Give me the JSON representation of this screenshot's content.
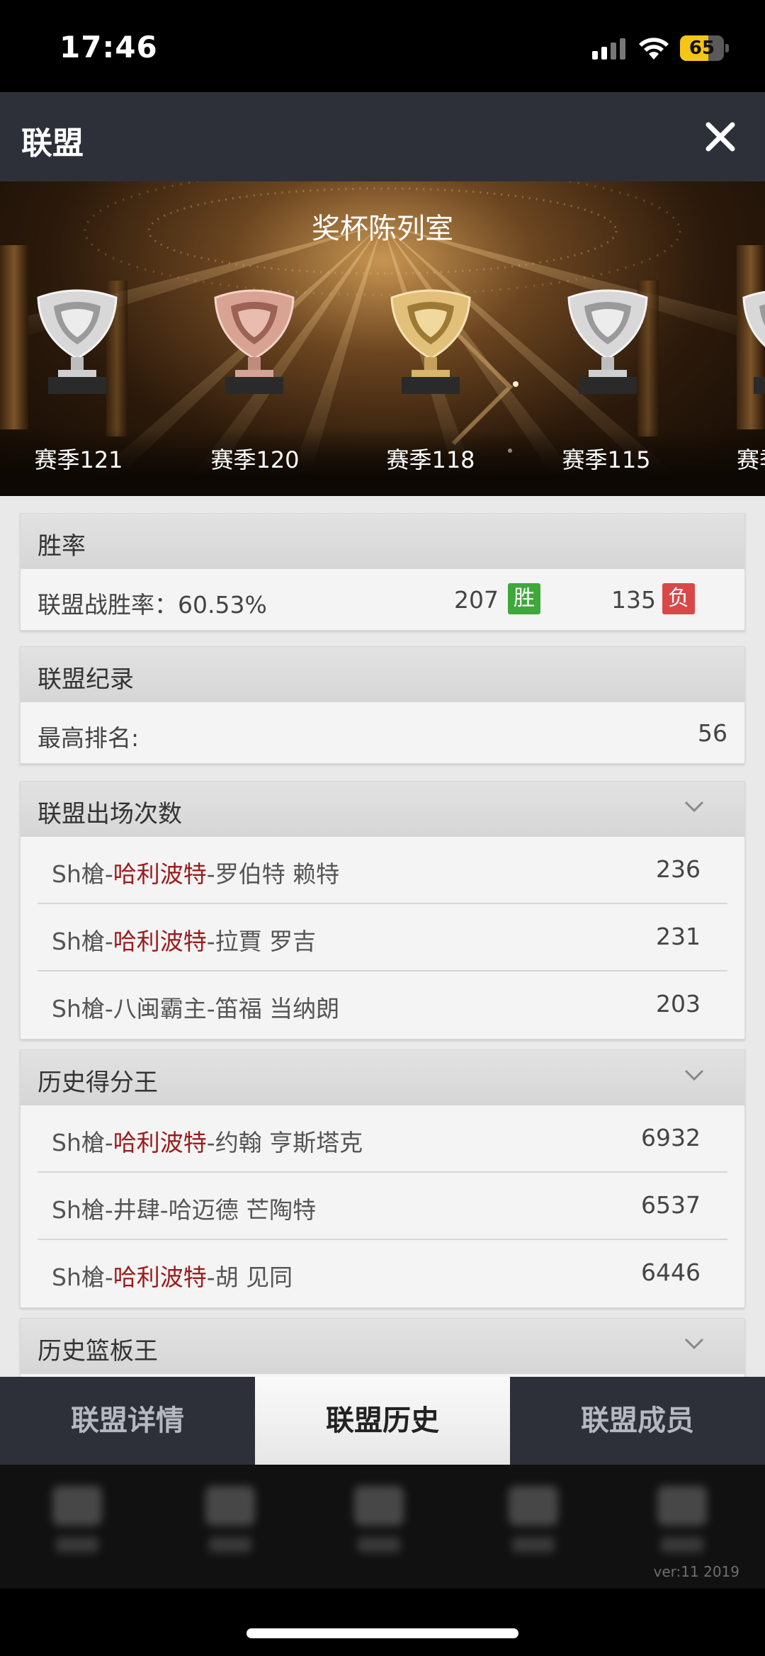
{
  "status_bar": {
    "time": "17:46",
    "battery": "65",
    "battery_level": 0.65
  },
  "header": {
    "title": "联盟"
  },
  "banner": {
    "title": "奖杯陈列室",
    "trophies": [
      {
        "season": "赛季121",
        "type": "silver"
      },
      {
        "season": "赛季120",
        "type": "bronze"
      },
      {
        "season": "赛季118",
        "type": "gold"
      },
      {
        "season": "赛季115",
        "type": "silver"
      },
      {
        "season": "赛季",
        "type": "silver"
      }
    ]
  },
  "win_rate": {
    "section": "胜率",
    "label": "联盟战胜率：60.53%",
    "wins": "207",
    "win_badge": "胜",
    "losses": "135",
    "loss_badge": "负"
  },
  "record": {
    "section": "联盟纪录",
    "label": "最高排名:",
    "value": "56"
  },
  "appearances": {
    "section": "联盟出场次数",
    "rows": [
      {
        "prefix": "Sh槍-",
        "team": "哈利波特",
        "suffix": "-罗伯特 赖特",
        "value": "236"
      },
      {
        "prefix": "Sh槍-",
        "team": "哈利波特",
        "suffix": "-拉賈 罗吉",
        "value": "231"
      },
      {
        "prefix": "Sh槍-",
        "team": "",
        "suffix": "八闽霸主-笛福 当纳朗",
        "value": "203"
      }
    ]
  },
  "scorers": {
    "section": "历史得分王",
    "rows": [
      {
        "prefix": "Sh槍-",
        "team": "哈利波特",
        "suffix": "-约翰 亨斯塔克",
        "value": "6932"
      },
      {
        "prefix": "Sh槍-",
        "team": "",
        "suffix": "井肆-哈迈德 芒陶特",
        "value": "6537"
      },
      {
        "prefix": "Sh槍-",
        "team": "哈利波特",
        "suffix": "-胡 见同",
        "value": "6446"
      }
    ]
  },
  "rebounds": {
    "section": "历史篮板王"
  },
  "tabs": [
    {
      "label": "联盟详情",
      "active": false
    },
    {
      "label": "联盟历史",
      "active": true
    },
    {
      "label": "联盟成员",
      "active": false
    }
  ],
  "version": "ver:11  2019",
  "colors": {
    "header": "#2d3038",
    "win": "#3fa83a",
    "loss": "#d94848",
    "highlight": "#9b1b1b"
  }
}
